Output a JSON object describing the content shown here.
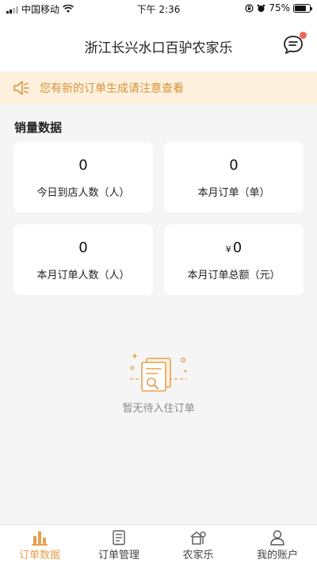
{
  "status_bar": {
    "carrier": "中国移动",
    "time": "下午 2:36",
    "battery_percent": "75%",
    "battery_level": 0.75
  },
  "header": {
    "title": "浙江长兴水口百驴农家乐",
    "message_icon": "chat-bubble-icon",
    "has_unread": true
  },
  "notice": {
    "icon": "speaker-icon",
    "text": "您有新的订单生成请注意查看"
  },
  "sales": {
    "title": "销量数据",
    "cards": [
      {
        "value": "0",
        "label": "今日到店人数（人）"
      },
      {
        "value": "0",
        "label": "本月订单（单）"
      },
      {
        "value": "0",
        "label": "本月订单人数（人）"
      },
      {
        "value": "0",
        "currency": "¥",
        "label": "本月订单总额（元）"
      }
    ]
  },
  "empty_state": {
    "icon": "empty-document-icon",
    "text": "暂无待入住订单"
  },
  "tab_bar": {
    "tabs": [
      {
        "label": "订单数据",
        "icon": "bar-chart-icon",
        "active": true
      },
      {
        "label": "订单管理",
        "icon": "document-icon",
        "active": false
      },
      {
        "label": "农家乐",
        "icon": "house-icon",
        "active": false
      },
      {
        "label": "我的账户",
        "icon": "user-icon",
        "active": false
      }
    ]
  },
  "colors": {
    "accent": "#e7a04b",
    "notice_bg": "#fdf1de",
    "notice_text": "#d9913a",
    "unread_dot": "#f0675a",
    "page_bg": "#f5f5f5"
  }
}
